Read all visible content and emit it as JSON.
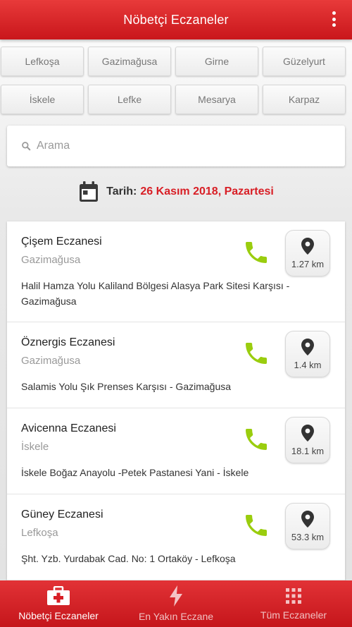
{
  "header": {
    "title": "Nöbetçi Eczaneler",
    "menu_icon": "more-vert-icon"
  },
  "cities": [
    "Lefkoşa",
    "Gazimağusa",
    "Girne",
    "Güzelyurt",
    "İskele",
    "Lefke",
    "Mesarya",
    "Karpaz"
  ],
  "search": {
    "placeholder": "Arama",
    "value": "",
    "icon": "search-icon"
  },
  "date": {
    "label": "Tarih:",
    "value": "26 Kasım 2018, Pazartesi",
    "icon": "calendar-icon"
  },
  "pharmacies": [
    {
      "name": "Çişem Eczanesi",
      "city": "Gazimağusa",
      "address": "Halil Hamza Yolu Kaliland Bölgesi Alasya Park Sitesi Karşısı - Gazimağusa",
      "distance": "1.27 km"
    },
    {
      "name": "Öznergis Eczanesi",
      "city": "Gazimağusa",
      "address": "Salamis Yolu Şık Prenses Karşısı - Gazimağusa",
      "distance": "1.4 km"
    },
    {
      "name": "Avicenna Eczanesi",
      "city": "İskele",
      "address": "İskele Boğaz Anayolu -Petek Pastanesi Yani - İskele",
      "distance": "18.1 km"
    },
    {
      "name": "Güney Eczanesi",
      "city": "Lefkoşa",
      "address": "Şht. Yzb. Yurdabak Cad. No: 1 Ortaköy - Lefkoşa",
      "distance": "53.3 km"
    }
  ],
  "bottom_nav": [
    {
      "label": "Nöbetçi Eczaneler",
      "icon": "first-aid-kit-icon",
      "active": true
    },
    {
      "label": "En Yakın Eczane",
      "icon": "lightning-icon",
      "active": false
    },
    {
      "label": "Tüm Eczaneler",
      "icon": "grid-icon",
      "active": false
    }
  ],
  "colors": {
    "primary": "#d81e25",
    "phone": "#9acd0e",
    "text": "#222222",
    "muted": "#999999"
  }
}
